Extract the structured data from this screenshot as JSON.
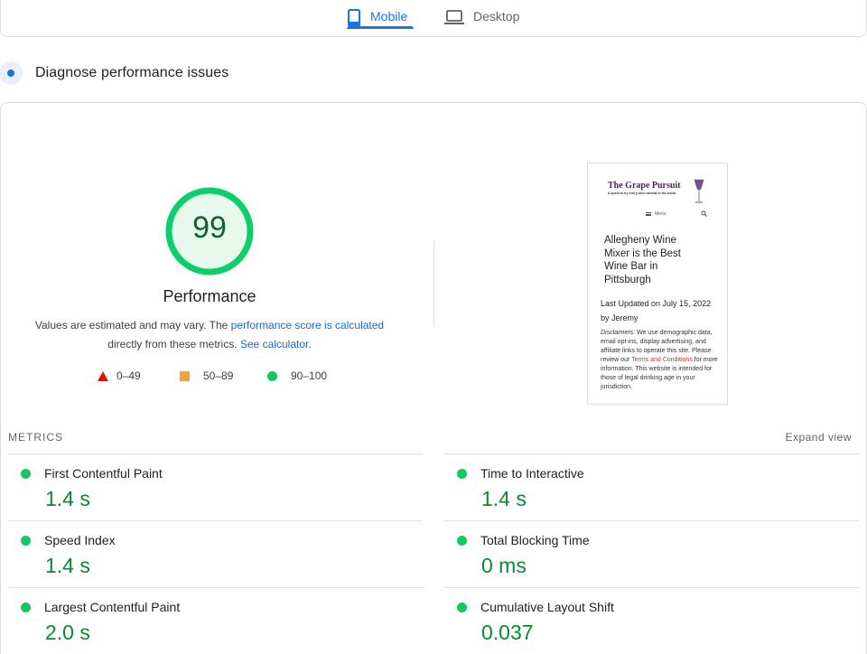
{
  "tabs": {
    "mobile_label": "Mobile",
    "desktop_label": "Desktop"
  },
  "diagnose": {
    "title": "Diagnose performance issues"
  },
  "score": {
    "value": "99",
    "fraction": 0.99,
    "category": "Performance",
    "desc_part1": "Values are estimated and may vary. The ",
    "desc_link1": "performance score is calculated",
    "desc_part2": " directly from these metrics. ",
    "desc_link2": "See calculator",
    "desc_part3": ".",
    "color_pass": "#0cce6b"
  },
  "legend": {
    "fail": "0–49",
    "average": "50–89",
    "pass": "90–100"
  },
  "thumbnail": {
    "brand": "The Grape Pursuit",
    "tagline": "A quest to try every wine varietal in the world",
    "menu": "Menu",
    "headline": "Allegheny Wine Mixer is the Best Wine Bar in Pittsburgh",
    "updated": "Last Updated on July 15, 2022 by Jeremy",
    "disc_label": "Disclaimers:",
    "disc_part1": " We use demographic data, email opt-ins, display advertising, and affiliate links to operate this site. Please review our ",
    "disc_link": "Terms and Conditions",
    "disc_part2": " for more information. This website is intended for those of legal drinking age in your jurisdiction."
  },
  "metrics": {
    "label": "METRICS",
    "expand": "Expand view",
    "items": [
      {
        "name": "First Contentful Paint",
        "value": "1.4 s"
      },
      {
        "name": "Time to Interactive",
        "value": "1.4 s"
      },
      {
        "name": "Speed Index",
        "value": "1.4 s"
      },
      {
        "name": "Total Blocking Time",
        "value": "0 ms"
      },
      {
        "name": "Largest Contentful Paint",
        "value": "2.0 s"
      },
      {
        "name": "Cumulative Layout Shift",
        "value": "0.037"
      }
    ]
  }
}
